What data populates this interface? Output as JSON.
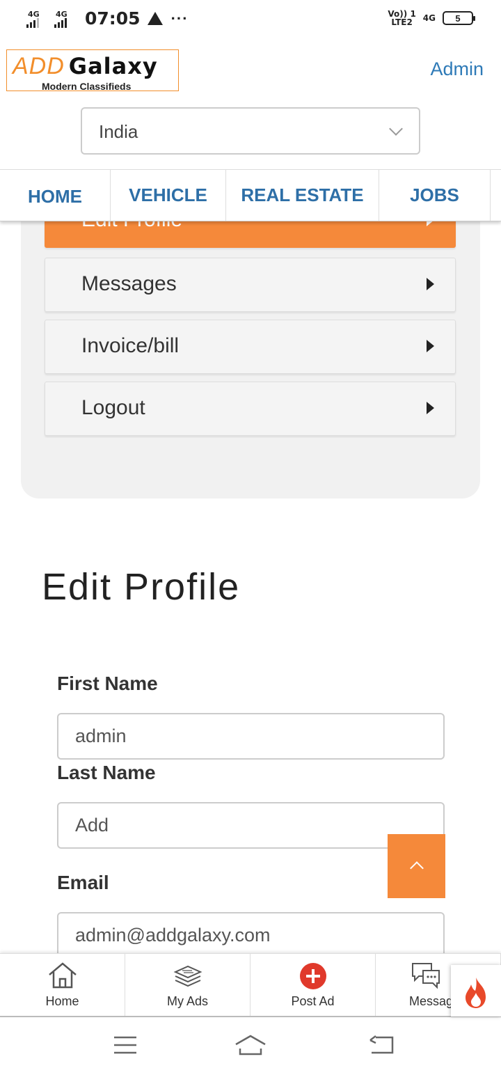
{
  "status_bar": {
    "network1": "4G",
    "network2": "4G",
    "time": "07:05",
    "volte_line1": "Vo)) 1",
    "volte_line2": "LTE2",
    "network3": "4G",
    "battery": "5"
  },
  "header": {
    "logo_add": "ADD",
    "logo_galaxy": "Galaxy",
    "logo_tagline": "Modern Classifieds",
    "admin_link": "Admin"
  },
  "country_select": {
    "value": "India"
  },
  "nav": {
    "items": [
      {
        "label": "HOME"
      },
      {
        "label": "VEHICLE"
      },
      {
        "label": "REAL ESTATE"
      },
      {
        "label": "JOBS"
      }
    ]
  },
  "menu": {
    "items": [
      {
        "label": "Edit Profile"
      },
      {
        "label": "Messages"
      },
      {
        "label": "Invoice/bill"
      },
      {
        "label": "Logout"
      }
    ]
  },
  "page_title": "Edit Profile",
  "form": {
    "first_name_label": "First Name",
    "first_name_value": "admin",
    "last_name_label": "Last Name",
    "last_name_value": "Add",
    "email_label": "Email",
    "email_value": "admin@addgalaxy.com"
  },
  "bottom_tabs": [
    {
      "label": "Home",
      "icon": "home-icon"
    },
    {
      "label": "My Ads",
      "icon": "stack-icon"
    },
    {
      "label": "Post Ad",
      "icon": "plus-circle-icon"
    },
    {
      "label": "Messag",
      "icon": "chat-icon"
    }
  ],
  "colors": {
    "accent_orange": "#f5893a",
    "link_blue": "#2e7ab7",
    "nav_blue": "#2e6fa7",
    "post_red": "#e0392b"
  }
}
